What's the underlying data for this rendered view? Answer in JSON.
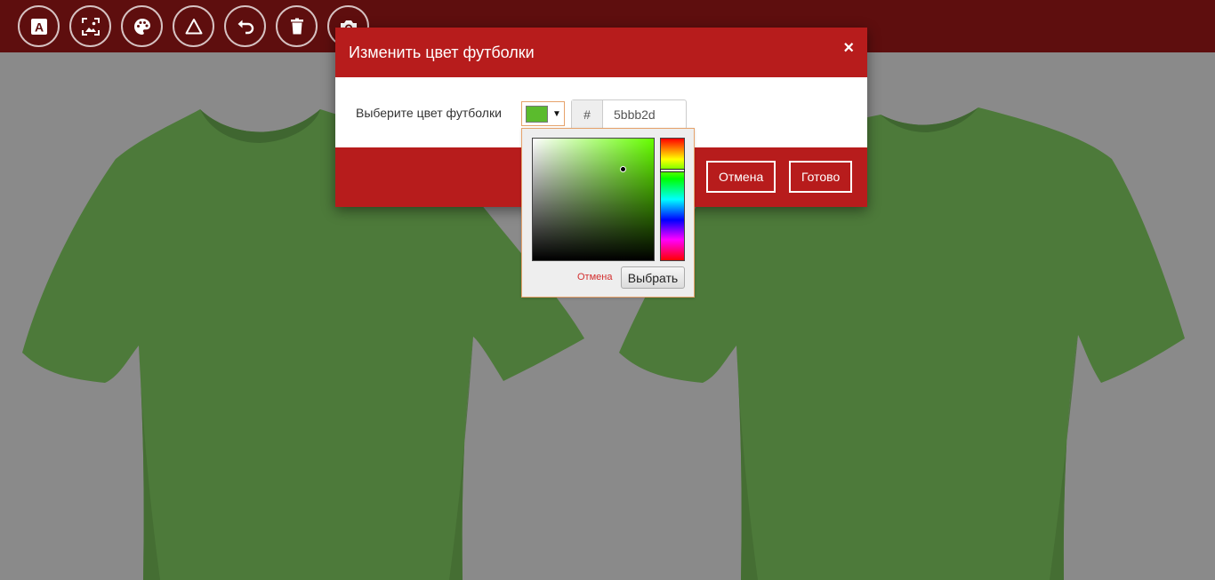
{
  "toolbar": {
    "buttons": [
      {
        "name": "text-tool-icon",
        "label": "A"
      },
      {
        "name": "image-tool-icon"
      },
      {
        "name": "palette-icon"
      },
      {
        "name": "shape-icon"
      },
      {
        "name": "undo-icon"
      },
      {
        "name": "trash-icon"
      },
      {
        "name": "camera-icon"
      }
    ]
  },
  "shirt": {
    "color": "#4d7a3a",
    "shade": "#436c32"
  },
  "modal": {
    "title": "Изменить цвет футболки",
    "close_glyph": "×",
    "color_label": "Выберите цвет футболки",
    "swatch_color": "#5bbb2d",
    "caret": "▼",
    "hex_prefix": "#",
    "hex_value": "5bbb2d",
    "cancel_label": "Отмена",
    "done_label": "Готово"
  },
  "picker": {
    "hue_color": "#66ff00",
    "cancel_label": "Отмена",
    "choose_label": "Выбрать"
  }
}
